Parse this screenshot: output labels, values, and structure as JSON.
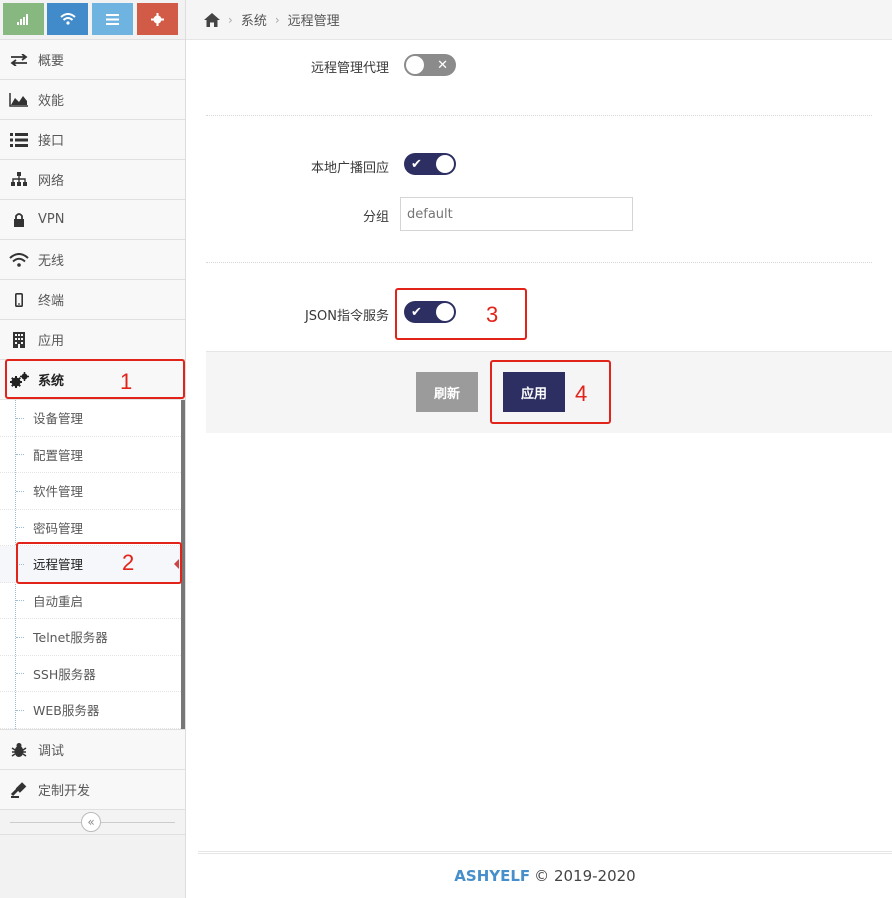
{
  "shortcuts": [
    {
      "icon": "signal-icon"
    },
    {
      "icon": "wifi-icon"
    },
    {
      "icon": "list-icon"
    },
    {
      "icon": "gear-icon"
    }
  ],
  "nav": {
    "overview": "概要",
    "performance": "效能",
    "interface": "接口",
    "network": "网络",
    "vpn": "VPN",
    "wireless": "无线",
    "terminal": "终端",
    "apps": "应用",
    "system": "系统",
    "debug": "调试",
    "custom_dev": "定制开发"
  },
  "submenu": [
    "设备管理",
    "配置管理",
    "软件管理",
    "密码管理",
    "远程管理",
    "自动重启",
    "Telnet服务器",
    "SSH服务器",
    "WEB服务器"
  ],
  "collapse_symbol": "«",
  "breadcrumb": {
    "level1": "系统",
    "level2": "远程管理",
    "separator": "›"
  },
  "form": {
    "remote_proxy_label": "远程管理代理",
    "remote_proxy_enabled": false,
    "broadcast_label": "本地广播回应",
    "broadcast_enabled": true,
    "group_label": "分组",
    "group_placeholder": "default",
    "json_label": "JSON指令服务",
    "json_enabled": true,
    "refresh_label": "刷新",
    "apply_label": "应用"
  },
  "annotations": [
    "1",
    "2",
    "3",
    "4"
  ],
  "annotation_color": "#e2231a",
  "accent_color": "#2d2f63",
  "footer": {
    "brand": "ASHYELF",
    "copyright": "© 2019-2020"
  }
}
